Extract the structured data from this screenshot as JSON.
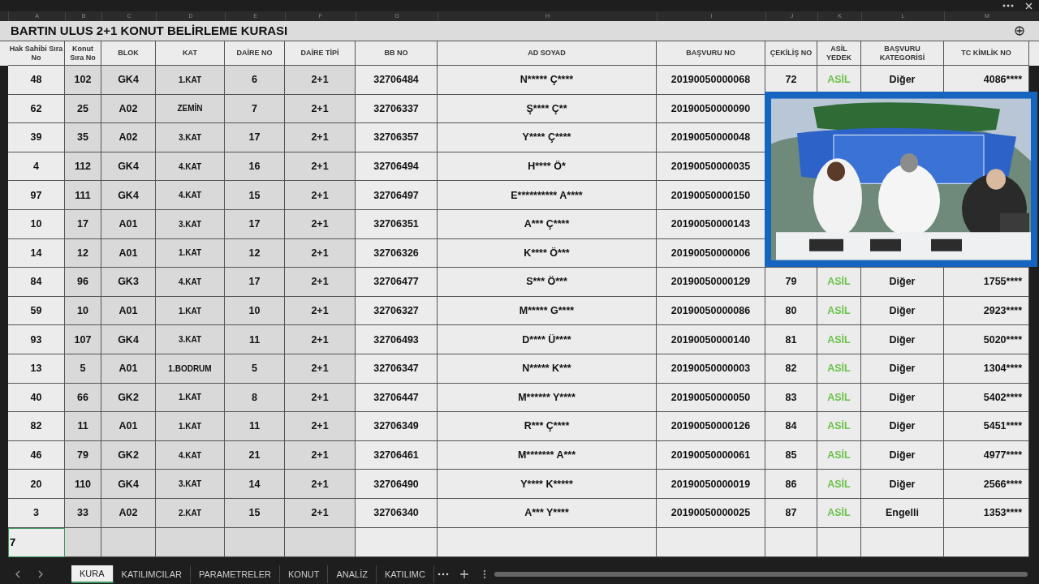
{
  "column_letters": [
    "A",
    "B",
    "C",
    "D",
    "E",
    "F",
    "G",
    "H",
    "I",
    "J",
    "K",
    "L",
    "M"
  ],
  "title": "BARTIN ULUS 2+1 KONUT BELİRLEME KURASI",
  "columns": [
    "Hak Sahibi Sıra No",
    "Konut Sıra No",
    "BLOK",
    "KAT",
    "DAİRE NO",
    "DAİRE TİPİ",
    "BB NO",
    "AD SOYAD",
    "BAŞVURU NO",
    "ÇEKİLİŞ NO",
    "ASİL YEDEK",
    "BAŞVURU KATEGORİSİ",
    "TC KİMLİK NO"
  ],
  "rows": [
    {
      "cells": [
        "48",
        "102",
        "GK4",
        "1.KAT",
        "6",
        "2+1",
        "32706484",
        "N***** Ç****",
        "20190050000068",
        "72",
        "ASİL",
        "Diğer",
        "4086****"
      ]
    },
    {
      "cells": [
        "62",
        "25",
        "A02",
        "ZEMİN",
        "7",
        "2+1",
        "32706337",
        "Ş**** Ç**",
        "20190050000090"
      ]
    },
    {
      "cells": [
        "39",
        "35",
        "A02",
        "3.KAT",
        "17",
        "2+1",
        "32706357",
        "Y**** Ç****",
        "20190050000048"
      ]
    },
    {
      "cells": [
        "4",
        "112",
        "GK4",
        "4.KAT",
        "16",
        "2+1",
        "32706494",
        "H**** Ö*",
        "20190050000035"
      ]
    },
    {
      "cells": [
        "97",
        "111",
        "GK4",
        "4.KAT",
        "15",
        "2+1",
        "32706497",
        "E********** A****",
        "20190050000150"
      ]
    },
    {
      "cells": [
        "10",
        "17",
        "A01",
        "3.KAT",
        "17",
        "2+1",
        "32706351",
        "A*** Ç****",
        "20190050000143"
      ]
    },
    {
      "cells": [
        "14",
        "12",
        "A01",
        "1.KAT",
        "12",
        "2+1",
        "32706326",
        "K**** Ö***",
        "20190050000006"
      ]
    },
    {
      "cells": [
        "84",
        "96",
        "GK3",
        "4.KAT",
        "17",
        "2+1",
        "32706477",
        "S*** Ö***",
        "20190050000129",
        "79",
        "ASİL",
        "Diğer",
        "1755****"
      ]
    },
    {
      "cells": [
        "59",
        "10",
        "A01",
        "1.KAT",
        "10",
        "2+1",
        "32706327",
        "M***** G****",
        "20190050000086",
        "80",
        "ASİL",
        "Diğer",
        "2923****"
      ]
    },
    {
      "cells": [
        "93",
        "107",
        "GK4",
        "3.KAT",
        "11",
        "2+1",
        "32706493",
        "D**** Ü****",
        "20190050000140",
        "81",
        "ASİL",
        "Diğer",
        "5020****"
      ]
    },
    {
      "cells": [
        "13",
        "5",
        "A01",
        "1.BODRUM",
        "5",
        "2+1",
        "32706347",
        "N***** K***",
        "20190050000003",
        "82",
        "ASİL",
        "Diğer",
        "1304****"
      ]
    },
    {
      "cells": [
        "40",
        "66",
        "GK2",
        "1.KAT",
        "8",
        "2+1",
        "32706447",
        "M****** Y****",
        "20190050000050",
        "83",
        "ASİL",
        "Diğer",
        "5402****"
      ]
    },
    {
      "cells": [
        "82",
        "11",
        "A01",
        "1.KAT",
        "11",
        "2+1",
        "32706349",
        "R*** Ç****",
        "20190050000126",
        "84",
        "ASİL",
        "Diğer",
        "5451****"
      ]
    },
    {
      "cells": [
        "46",
        "79",
        "GK2",
        "4.KAT",
        "21",
        "2+1",
        "32706461",
        "M******* A***",
        "20190050000061",
        "85",
        "ASİL",
        "Diğer",
        "4977****"
      ]
    },
    {
      "cells": [
        "20",
        "110",
        "GK4",
        "3.KAT",
        "14",
        "2+1",
        "32706490",
        "Y**** K*****",
        "20190050000019",
        "86",
        "ASİL",
        "Diğer",
        "2566****"
      ]
    },
    {
      "cells": [
        "3",
        "33",
        "A02",
        "2.KAT",
        "15",
        "2+1",
        "32706340",
        "A*** Y****",
        "20190050000025",
        "87",
        "ASİL",
        "Engelli",
        "1353****"
      ]
    }
  ],
  "editing_cell": {
    "value": "7"
  },
  "tabs": [
    {
      "label": "KURA",
      "selected": true
    },
    {
      "label": "KATILIMCILAR",
      "selected": false
    },
    {
      "label": "PARAMETRELER",
      "selected": false
    },
    {
      "label": "KONUT",
      "selected": false
    },
    {
      "label": "ANALİZ",
      "selected": false
    },
    {
      "label": "KATILIMC",
      "selected": false
    }
  ]
}
